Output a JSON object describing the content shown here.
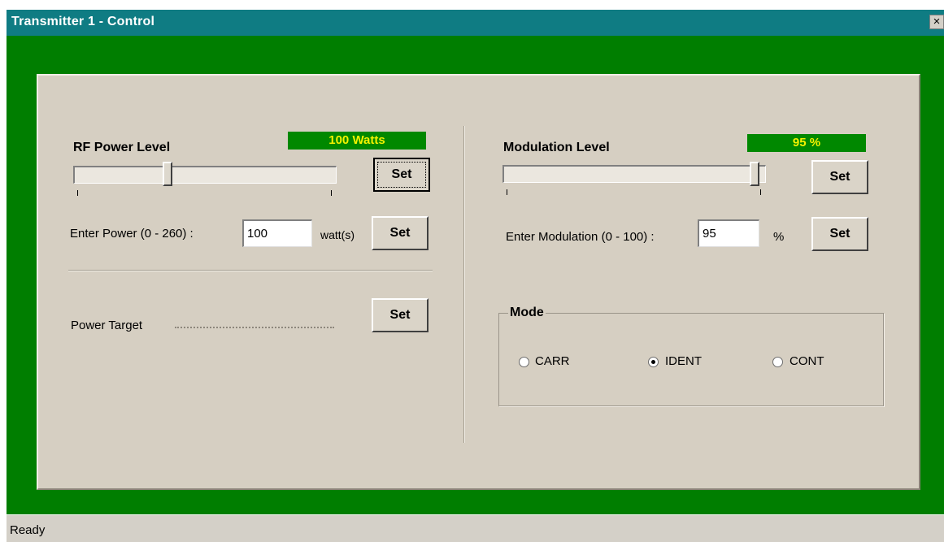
{
  "window": {
    "title": "Transmitter 1 - Control",
    "close_glyph": "×",
    "accent": "#007e00",
    "titlebar_color": "#0f7c83"
  },
  "rf": {
    "heading": "RF Power Level",
    "readout": "100 Watts",
    "slider_fraction": 0.38,
    "set_label": "Set",
    "enter_label": "Enter Power (0 - 260) :",
    "input_value": "100",
    "unit": "watt(s)",
    "enter_set_label": "Set",
    "target_label": "Power Target",
    "target_set_label": "Set"
  },
  "modulation": {
    "heading": "Modulation Level",
    "readout": "95 %",
    "slider_fraction": 0.95,
    "set_label": "Set",
    "enter_label": "Enter Modulation (0 - 100) :",
    "input_value": "95",
    "unit": "%",
    "enter_set_label": "Set"
  },
  "mode": {
    "legend": "Mode",
    "options": [
      {
        "label": "CARR",
        "selected": false
      },
      {
        "label": "IDENT",
        "selected": true
      },
      {
        "label": "CONT",
        "selected": false
      }
    ]
  },
  "status": {
    "text": "Ready"
  }
}
